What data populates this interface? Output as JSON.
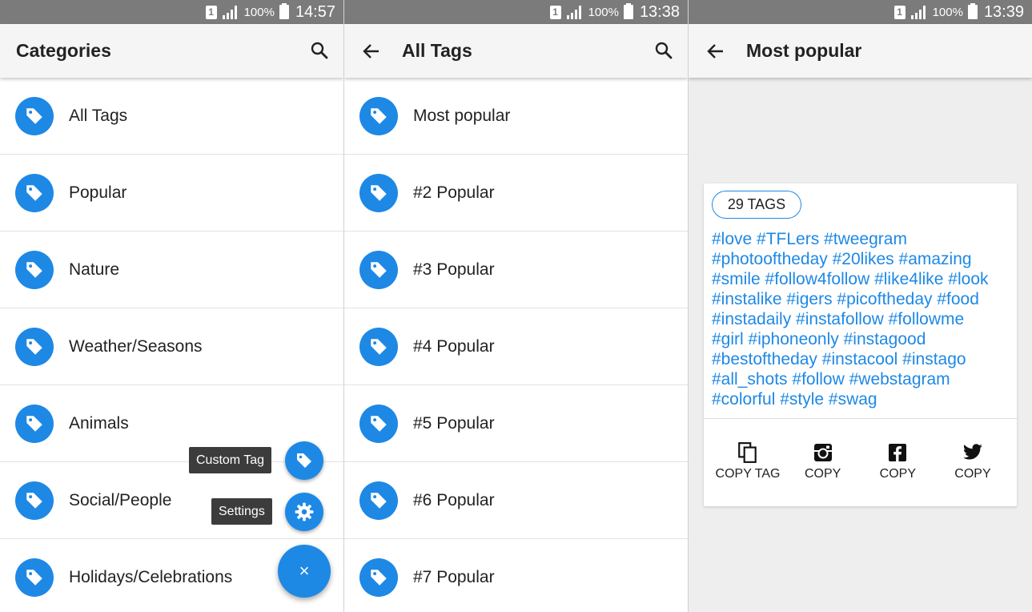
{
  "status_bars": [
    {
      "sim": "1",
      "battery": "100%",
      "time": "14:57"
    },
    {
      "sim": "1",
      "battery": "100%",
      "time": "13:38"
    },
    {
      "sim": "1",
      "battery": "100%",
      "time": "13:39"
    }
  ],
  "screen_categories": {
    "title": "Categories",
    "search_icon": "search-icon",
    "items": [
      {
        "label": "All Tags"
      },
      {
        "label": "Popular"
      },
      {
        "label": "Nature"
      },
      {
        "label": "Weather/Seasons"
      },
      {
        "label": "Animals"
      },
      {
        "label": "Social/People"
      },
      {
        "label": "Holidays/Celebrations"
      }
    ],
    "fab_menu": {
      "custom_tag_label": "Custom Tag",
      "settings_label": "Settings",
      "close_glyph": "×"
    }
  },
  "screen_all_tags": {
    "title": "All Tags",
    "items": [
      {
        "label": "Most popular"
      },
      {
        "label": "#2 Popular"
      },
      {
        "label": "#3 Popular"
      },
      {
        "label": "#4 Popular"
      },
      {
        "label": "#5 Popular"
      },
      {
        "label": "#6 Popular"
      },
      {
        "label": "#7 Popular"
      }
    ]
  },
  "screen_most_popular": {
    "title": "Most popular",
    "tag_count": "29 TAGS",
    "tag_lines": [
      "#love #TFLers #tweegram",
      "#photooftheday #20likes #amazing",
      "#smile #follow4follow #like4like #look",
      "#instalike #igers #picoftheday #food",
      "#instadaily #instafollow #followme",
      "#girl #iphoneonly #instagood",
      "#bestoftheday #instacool #instago",
      "#all_shots #follow #webstagram",
      "#colorful #style #swag"
    ],
    "actions": [
      {
        "label": "COPY TAG",
        "icon": "copy-icon"
      },
      {
        "label": "COPY",
        "icon": "instagram-icon"
      },
      {
        "label": "COPY",
        "icon": "facebook-icon"
      },
      {
        "label": "COPY",
        "icon": "twitter-icon"
      }
    ]
  },
  "colors": {
    "accent": "#1e88e5",
    "status_bar": "#7b7b7b",
    "app_bar": "#f5f5f5"
  }
}
